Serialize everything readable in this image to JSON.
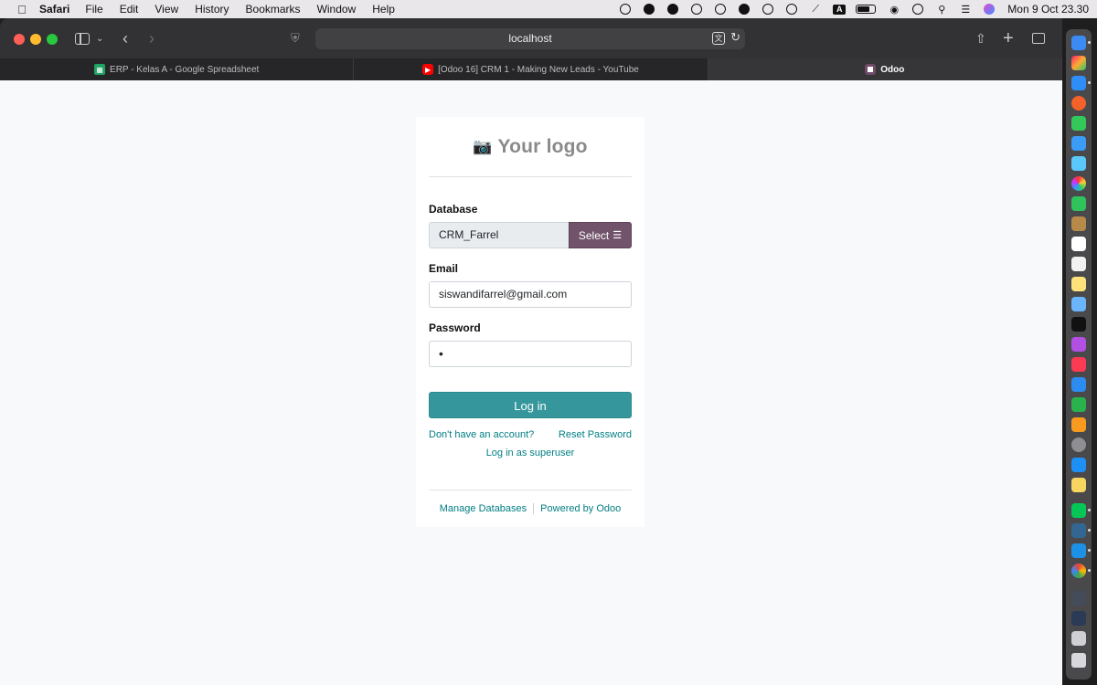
{
  "menubar": {
    "app_name": "Safari",
    "items": [
      "File",
      "Edit",
      "View",
      "History",
      "Bookmarks",
      "Window",
      "Help"
    ],
    "status_a_label": "A",
    "clock": "Mon 9 Oct  23.30"
  },
  "browser": {
    "url": "localhost",
    "tabs": [
      {
        "title": "ERP - Kelas A - Google Spreadsheet",
        "icon": "sheets-icon"
      },
      {
        "title": "[Odoo 16] CRM 1 - Making New Leads - YouTube",
        "icon": "youtube-icon"
      },
      {
        "title": "Odoo",
        "icon": "odoo-icon"
      }
    ]
  },
  "login": {
    "logo_text": "Your logo",
    "database_label": "Database",
    "database_value": "CRM_Farrel",
    "select_label": "Select",
    "email_label": "Email",
    "email_value": "siswandifarrel@gmail.com",
    "password_label": "Password",
    "password_value": "•",
    "login_button": "Log in",
    "signup_link": "Don't have an account?",
    "reset_link": "Reset Password",
    "superuser_link": "Log in as superuser",
    "manage_db_link": "Manage Databases",
    "powered_by_link": "Powered by Odoo"
  },
  "colors": {
    "accent": "#35979c",
    "brand": "#71536b",
    "link": "#017e84"
  }
}
